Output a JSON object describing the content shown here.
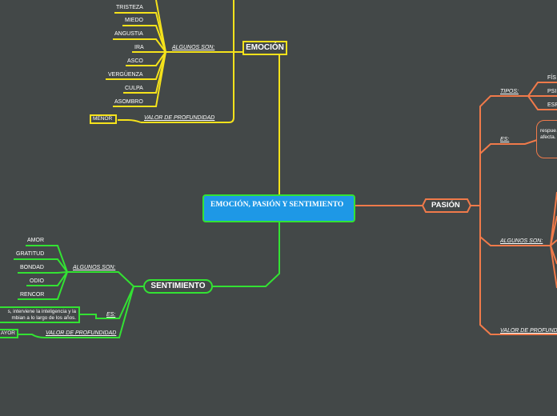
{
  "central": {
    "title": "EMOCIÓN, PASIÓN Y SENTIMIENTO"
  },
  "emocion": {
    "title": "EMOCIÓN",
    "algunos_label": "ALGUNOS SON:",
    "items": [
      "TRISTEZA",
      "MIEDO",
      "ANGUSTIA",
      "IRA",
      "ASCO",
      "VERGÜENZA",
      "CULPA",
      "ASOMBRO"
    ],
    "valor_label": "VALOR DE PROFUNDIDAD",
    "valor_value": "MENOR"
  },
  "pasion": {
    "title": "PASIÓN",
    "tipos_label": "TIPOS:",
    "tipos": [
      "FÍS",
      "PSI",
      "ESP"
    ],
    "es_label": "ES:",
    "es_text": "respue… afecta.",
    "algunos_label": "ALGUNOS SON:",
    "valor_label": "VALOR DE PROFUND"
  },
  "sentimiento": {
    "title": "SENTIMIENTO",
    "algunos_label": "ALGUNOS SON:",
    "items": [
      "AMOR",
      "GRATITUD",
      "BONDAD",
      "ODIO",
      "RENCOR"
    ],
    "es_label": "ES:",
    "es_text": "s, interviene la inteligencia y la mbian a lo largo de los años.",
    "valor_label": "VALOR DE PROFUNDIDAD",
    "valor_value": "AYOR"
  },
  "colors": {
    "background": "#434848",
    "emocion": "#f5e21b",
    "sentimiento": "#33e233",
    "pasion": "#f07a4a",
    "central_fill": "#1e98e6"
  }
}
